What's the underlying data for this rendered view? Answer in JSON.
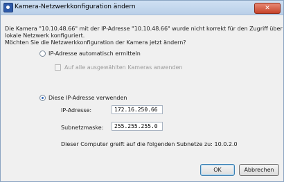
{
  "window": {
    "title": "Kamera-Netzwerkkonfiguration ändern",
    "close_label": "✕"
  },
  "message": {
    "line1": "Die Kamera \"10.10.48.66\" mit der IP-Adresse \"10.10.48.66\" wurde nicht korrekt für den Zugriff über das",
    "line2": "lokale Netzwerk konfiguriert.",
    "line3": "Möchten Sie die Netzwerkkonfiguration der Kamera jetzt ändern?"
  },
  "options": {
    "auto_label": "IP-Adresse automatisch ermitteln",
    "auto_selected": false,
    "apply_all_label": "Auf alle ausgewählten Kameras anwenden",
    "apply_all_checked": false,
    "manual_label": "Diese IP-Adresse verwenden",
    "manual_selected": true
  },
  "fields": {
    "ip_label": "IP-Adresse:",
    "ip_value": "172.16.250.66",
    "subnet_label": "Subnetzmaske:",
    "subnet_value": "255.255.255.0"
  },
  "info": "Dieser Computer greift auf die folgenden Subnetze zu: 10.0.2.0",
  "buttons": {
    "ok": "OK",
    "cancel": "Abbrechen"
  },
  "colors": {
    "accent": "#2a63b8",
    "close": "#c6432a"
  }
}
